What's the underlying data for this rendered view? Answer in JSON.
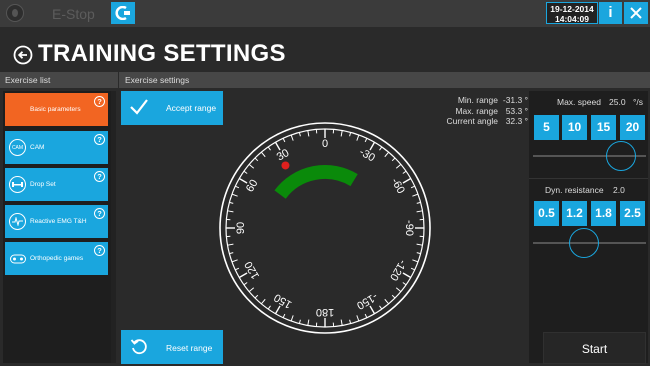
{
  "topbar": {
    "estop_label": "E-Stop",
    "date": "19-12-2014",
    "time": "14:04:09",
    "info_label": "i"
  },
  "page": {
    "title": "TRAINING SETTINGS"
  },
  "sections": {
    "exercise_list": "Exercise list",
    "exercise_settings": "Exercise settings"
  },
  "exercise_list": [
    {
      "label": "Basic parameters",
      "icon": "",
      "active": true
    },
    {
      "label": "CAM",
      "icon": "CAM",
      "active": false
    },
    {
      "label": "Drop Set",
      "icon": "",
      "active": false
    },
    {
      "label": "Reactive EMG T&H",
      "icon": "",
      "active": false
    },
    {
      "label": "Orthopedic games",
      "icon": "",
      "active": false
    }
  ],
  "help_glyph": "?",
  "settings": {
    "accept_label": "Accept range",
    "reset_label": "Reset range",
    "min_range_label": "Min. range",
    "min_range_value": "-31.3 °",
    "max_range_label": "Max. range",
    "max_range_value": "53.3 °",
    "current_angle_label": "Current angle",
    "current_angle_value": "32.3 °"
  },
  "dial": {
    "range_min": -31.3,
    "range_max": 53.3,
    "current_angle": 32.3,
    "labels": [
      "0",
      "-30",
      "-60",
      "-90",
      "-120",
      "-150",
      "180",
      "150",
      "120",
      "90",
      "60",
      "30"
    ],
    "range_color": "#0a8a0a",
    "marker_color": "#e0201e"
  },
  "controls": {
    "max_speed_label": "Max. speed",
    "max_speed_value": "25.0",
    "max_speed_unit": "°/s",
    "speed_options": [
      "5",
      "10",
      "15",
      "20"
    ],
    "speed_slider_value": 0.78,
    "dyn_res_label": "Dyn. resistance",
    "dyn_res_value": "2.0",
    "res_options": [
      "0.5",
      "1.2",
      "1.8",
      "2.5"
    ],
    "res_slider_value": 0.45,
    "start_label": "Start"
  },
  "colors": {
    "accent": "#1aa6de",
    "active": "#f26522",
    "background": "#2a2a2a"
  }
}
